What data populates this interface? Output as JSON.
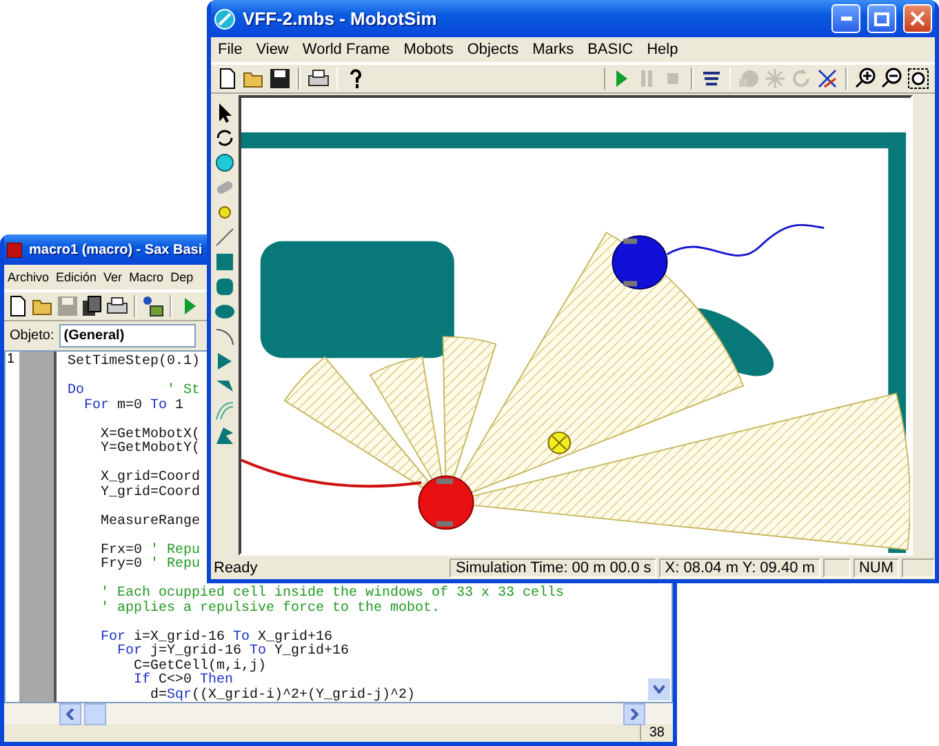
{
  "macro_window": {
    "title": "macro1 (macro) - Sax Basi",
    "menu": [
      "Archivo",
      "Edición",
      "Ver",
      "Macro",
      "Dep"
    ],
    "toolbar": [
      {
        "kind": "new",
        "disabled": false
      },
      {
        "kind": "open",
        "disabled": false
      },
      {
        "kind": "save",
        "disabled": true
      },
      {
        "kind": "copy",
        "disabled": false
      },
      {
        "kind": "print",
        "disabled": false
      },
      {
        "kind": "sep"
      },
      {
        "kind": "objects",
        "disabled": false
      },
      {
        "kind": "sep"
      },
      {
        "kind": "play",
        "disabled": false
      }
    ],
    "object_label": "Objeto:",
    "object_value": "(General)",
    "line_number": "1",
    "code_lines": [
      {
        "space_before": false,
        "segments": [
          {
            "kind": "plain",
            "text": "SetTimeStep(0.1)"
          }
        ]
      },
      {
        "space_before": true,
        "segments": [
          {
            "kind": "keyword",
            "text": "Do"
          },
          {
            "kind": "comment",
            "text": "          ' St"
          }
        ]
      },
      {
        "space_before": false,
        "segments": [
          {
            "kind": "keyword",
            "text": "  For "
          },
          {
            "kind": "plain",
            "text": "m=0 "
          },
          {
            "kind": "keyword",
            "text": "To"
          },
          {
            "kind": "plain",
            "text": " 1"
          }
        ]
      },
      {
        "space_before": true,
        "segments": [
          {
            "kind": "plain",
            "text": "    X=GetMobotX("
          }
        ]
      },
      {
        "space_before": false,
        "segments": [
          {
            "kind": "plain",
            "text": "    Y=GetMobotY("
          }
        ]
      },
      {
        "space_before": true,
        "segments": [
          {
            "kind": "plain",
            "text": "    X_grid=Coord"
          }
        ]
      },
      {
        "space_before": false,
        "segments": [
          {
            "kind": "plain",
            "text": "    Y_grid=Coord"
          }
        ]
      },
      {
        "space_before": true,
        "segments": [
          {
            "kind": "plain",
            "text": "    MeasureRange"
          }
        ]
      },
      {
        "space_before": true,
        "segments": [
          {
            "kind": "plain",
            "text": "    Frx=0 "
          },
          {
            "kind": "comment",
            "text": "' Repu"
          }
        ]
      },
      {
        "space_before": false,
        "segments": [
          {
            "kind": "plain",
            "text": "    Fry=0 "
          },
          {
            "kind": "comment",
            "text": "' Repu"
          }
        ]
      },
      {
        "space_before": true,
        "segments": [
          {
            "kind": "comment",
            "text": "    ' Each ocuppied cell inside the windows of 33 x 33 cells"
          }
        ]
      },
      {
        "space_before": false,
        "segments": [
          {
            "kind": "comment",
            "text": "    ' applies a repulsive force to the mobot."
          }
        ]
      },
      {
        "space_before": true,
        "segments": [
          {
            "kind": "keyword",
            "text": "    For "
          },
          {
            "kind": "plain",
            "text": "i=X_grid-16 "
          },
          {
            "kind": "keyword",
            "text": "To"
          },
          {
            "kind": "plain",
            "text": " X_grid+16"
          }
        ]
      },
      {
        "space_before": false,
        "segments": [
          {
            "kind": "keyword",
            "text": "      For "
          },
          {
            "kind": "plain",
            "text": "j=Y_grid-16 "
          },
          {
            "kind": "keyword",
            "text": "To"
          },
          {
            "kind": "plain",
            "text": " Y_grid+16"
          }
        ]
      },
      {
        "space_before": false,
        "segments": [
          {
            "kind": "plain",
            "text": "        C=GetCell(m,i,j)"
          }
        ]
      },
      {
        "space_before": false,
        "segments": [
          {
            "kind": "keyword",
            "text": "        If "
          },
          {
            "kind": "plain",
            "text": "C<>0 "
          },
          {
            "kind": "keyword",
            "text": "Then"
          }
        ]
      },
      {
        "space_before": false,
        "segments": [
          {
            "kind": "plain",
            "text": "          d="
          },
          {
            "kind": "keyword",
            "text": "Sqr"
          },
          {
            "kind": "plain",
            "text": "((X_grid-i)^2+(Y_grid-j)^2)"
          }
        ]
      }
    ],
    "status": "38"
  },
  "mobotsim_window": {
    "title": "VFF-2.mbs - MobotSim",
    "menu": [
      "File",
      "View",
      "World Frame",
      "Mobots",
      "Objects",
      "Marks",
      "BASIC",
      "Help"
    ],
    "toolbar": [
      {
        "kind": "new",
        "disabled": false
      },
      {
        "kind": "open",
        "disabled": false
      },
      {
        "kind": "save",
        "disabled": false
      },
      {
        "kind": "sep"
      },
      {
        "kind": "print",
        "disabled": false
      },
      {
        "kind": "sep"
      },
      {
        "kind": "help",
        "disabled": false
      },
      {
        "kind": "spacer"
      },
      {
        "kind": "play",
        "disabled": false
      },
      {
        "kind": "pause",
        "disabled": true
      },
      {
        "kind": "stop",
        "disabled": true
      },
      {
        "kind": "sep"
      },
      {
        "kind": "script",
        "disabled": false
      },
      {
        "kind": "sep"
      },
      {
        "kind": "shape",
        "disabled": true
      },
      {
        "kind": "rays",
        "disabled": true
      },
      {
        "kind": "rotate",
        "disabled": true
      },
      {
        "kind": "axes",
        "disabled": false
      },
      {
        "kind": "sep"
      },
      {
        "kind": "zoom-in",
        "disabled": false
      },
      {
        "kind": "zoom-out",
        "disabled": false
      },
      {
        "kind": "zoom-fit",
        "disabled": false
      }
    ],
    "status_bar": {
      "message": "Ready",
      "simulation_time": "Simulation Time: 00 m 00.0 s",
      "position": "X: 08.04 m  Y: 09.40 m",
      "num": "NUM"
    }
  }
}
